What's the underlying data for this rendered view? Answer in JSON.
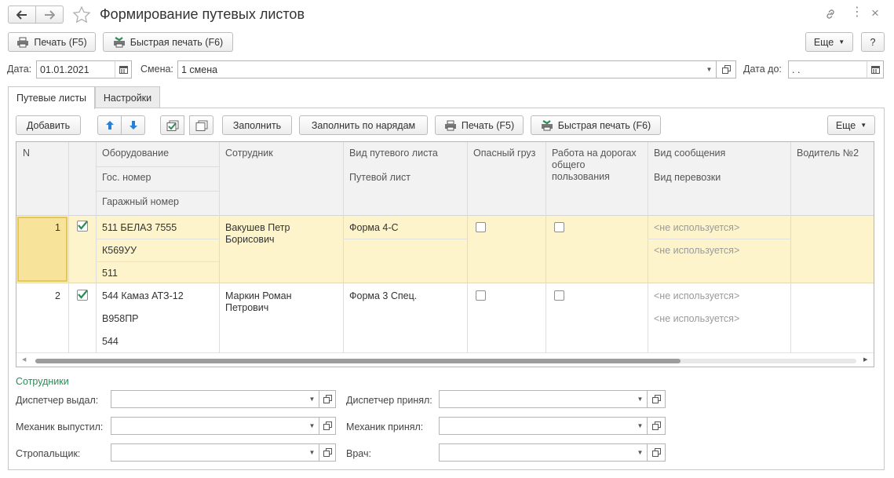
{
  "header": {
    "title": "Формирование путевых листов"
  },
  "toolbar": {
    "print_label": "Печать (F5)",
    "quick_print_label": "Быстрая печать (F6)",
    "more_label": "Еще",
    "help_label": "?"
  },
  "filters": {
    "date_label": "Дата:",
    "date_value": "01.01.2021",
    "shift_label": "Смена:",
    "shift_value": "1 смена",
    "date_to_label": "Дата до:",
    "date_to_value": " .  ."
  },
  "tabs": [
    {
      "label": "Путевые листы",
      "active": true
    },
    {
      "label": "Настройки",
      "active": false
    }
  ],
  "table_toolbar": {
    "add_label": "Добавить",
    "fill_label": "Заполнить",
    "fill_by_orders_label": "Заполнить по нарядам",
    "print_label": "Печать (F5)",
    "quick_print_label": "Быстрая печать (F6)",
    "more_label": "Еще"
  },
  "table": {
    "headers": {
      "n": "N",
      "equipment": "Оборудование",
      "gov_number": "Гос. номер",
      "garage_number": "Гаражный номер",
      "employee": "Сотрудник",
      "sheet_type": "Вид путевого листа",
      "waybill": "Путевой лист",
      "dangerous": "Опасный груз",
      "public_roads": "Работа на дорогах общего пользования",
      "communication": "Вид сообщения",
      "transport": "Вид перевозки",
      "driver2": "Водитель №2"
    },
    "rows": [
      {
        "n": "1",
        "checked": true,
        "equipment": "511 БЕЛАЗ 7555",
        "gov_number": "К569УУ",
        "garage_number": "511",
        "employee_line1": "Вакушев Петр",
        "employee_line2": "Борисович",
        "sheet_type": "Форма 4-С",
        "dangerous": false,
        "public_roads": false,
        "communication": "<не используется>",
        "transport": "<не используется>"
      },
      {
        "n": "2",
        "checked": true,
        "equipment": "544 Камаз АТЗ-12",
        "gov_number": "В958ПР",
        "garage_number": "544",
        "employee_line1": "Маркин Роман",
        "employee_line2": "Петрович",
        "sheet_type": "Форма 3 Спец.",
        "dangerous": false,
        "public_roads": false,
        "communication": "<не используется>",
        "transport": "<не используется>"
      }
    ]
  },
  "employees": {
    "section_title": "Сотрудники",
    "dispatcher_issued": "Диспетчер выдал:",
    "dispatcher_received": "Диспетчер принял:",
    "mechanic_released": "Механик выпустил:",
    "mechanic_received": "Механик принял:",
    "slinger": "Стропальщик:",
    "doctor": "Врач:"
  },
  "colors": {
    "accent_green": "#2e8b57",
    "selected_row": "#fdf4cc",
    "selected_cell": "#f7e39a"
  }
}
